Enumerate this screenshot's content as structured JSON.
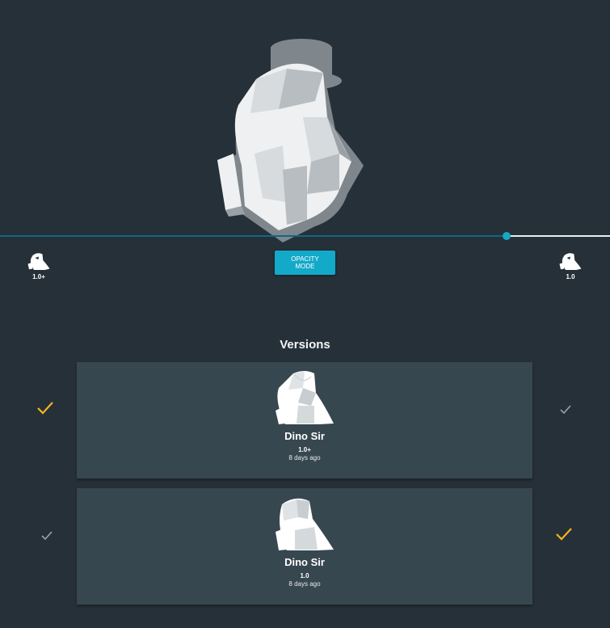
{
  "viewer": {
    "mode_button_label": "OPACITY\nMODE",
    "opacity_fraction": 0.83,
    "left_thumb_label": "1.0+",
    "right_thumb_label": "1.0"
  },
  "versions": {
    "title": "Versions",
    "items": [
      {
        "name": "Dino Sir",
        "version": "1.0+",
        "date": "8 days ago",
        "left_selected": true,
        "right_selected": false
      },
      {
        "name": "Dino Sir",
        "version": "1.0",
        "date": "8 days ago",
        "left_selected": false,
        "right_selected": true
      }
    ]
  },
  "colors": {
    "background": "#263038",
    "card": "#37474f",
    "accent": "#13a9c9",
    "selected_check": "#f2b51c",
    "unselected_check": "#9aa3a8"
  },
  "icons": {
    "thumbnail": "dino-icon",
    "selector": "check-icon"
  }
}
